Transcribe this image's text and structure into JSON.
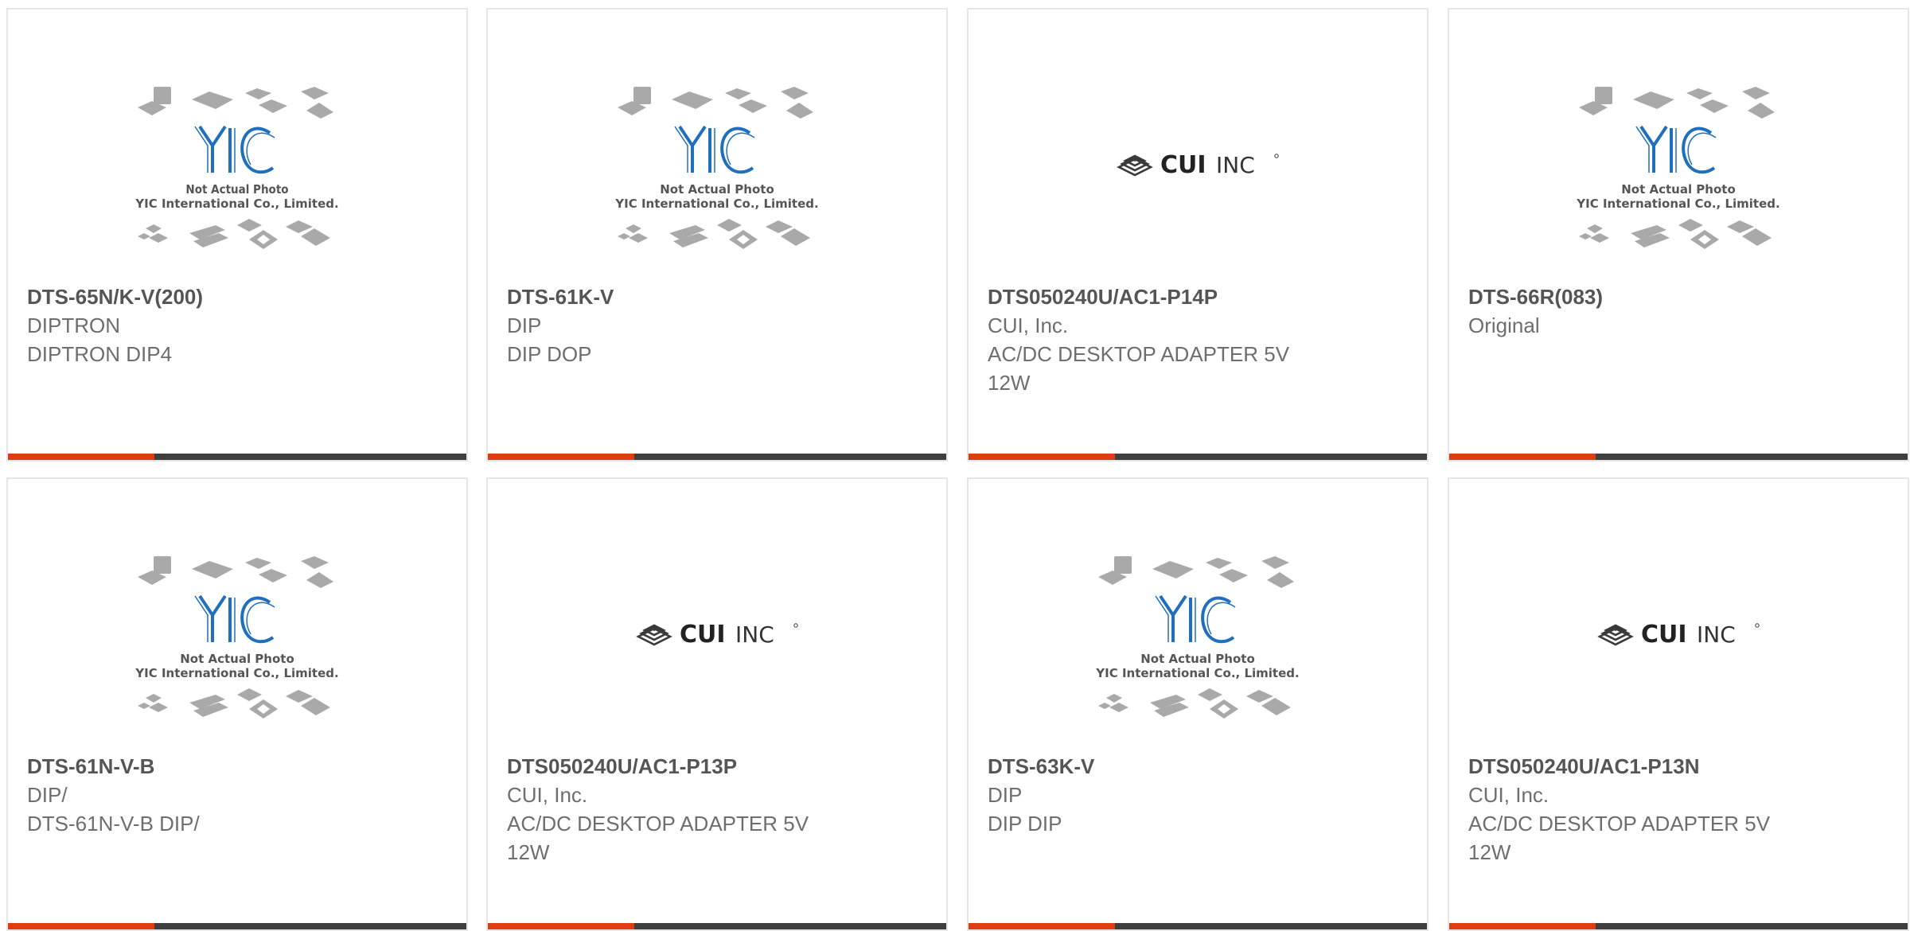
{
  "colors": {
    "accent": "#e03c12",
    "bar": "#3f3f3f",
    "title_text": "#555555",
    "body_text": "#6e6e6e",
    "yic_blue": "#1f6fbd"
  },
  "placeholder": {
    "logo_text": "YIC",
    "line1": "Not Actual Photo",
    "line2": "YIC International Co., Limited."
  },
  "cui_logo": {
    "brand": "CUI",
    "suffix": "INC"
  },
  "products": [
    {
      "image": "yic-placeholder",
      "part": "DTS-65N/K-V(200)",
      "manufacturer": "DIPTRON",
      "description": "DIPTRON DIP4"
    },
    {
      "image": "yic-placeholder",
      "part": "DTS-61K-V",
      "manufacturer": "DIP",
      "description": "DIP DOP"
    },
    {
      "image": "cui-logo",
      "part": "DTS050240U/AC1-P14P",
      "manufacturer": "CUI, Inc.",
      "description": "AC/DC DESKTOP ADAPTER 5V 12W"
    },
    {
      "image": "yic-placeholder",
      "part": "DTS-66R(083)",
      "manufacturer": "Original",
      "description": ""
    },
    {
      "image": "yic-placeholder",
      "part": "DTS-61N-V-B",
      "manufacturer": "DIP/",
      "description": "DTS-61N-V-B DIP/"
    },
    {
      "image": "cui-logo",
      "part": "DTS050240U/AC1-P13P",
      "manufacturer": "CUI, Inc.",
      "description": "AC/DC DESKTOP ADAPTER 5V 12W"
    },
    {
      "image": "yic-placeholder",
      "part": "DTS-63K-V",
      "manufacturer": "DIP",
      "description": "DIP DIP"
    },
    {
      "image": "cui-logo",
      "part": "DTS050240U/AC1-P13N",
      "manufacturer": "CUI, Inc.",
      "description": "AC/DC DESKTOP ADAPTER 5V 12W"
    }
  ]
}
